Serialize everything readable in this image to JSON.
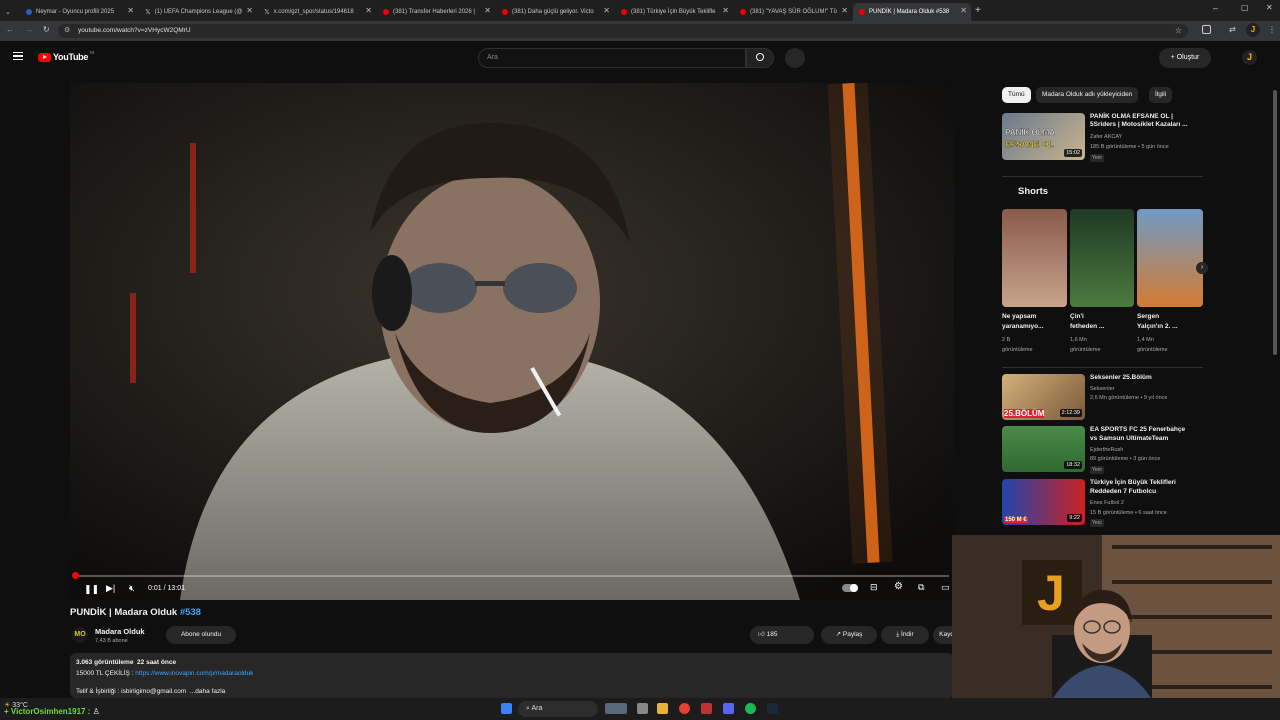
{
  "browser": {
    "tabs": [
      {
        "label": "Neymar - Oyuncu profili 2025"
      },
      {
        "label": "(1) UEFA Champions League (@"
      },
      {
        "label": "x.com/gzt_spor/status/194618"
      },
      {
        "label": "(381) Transfer Haberleri 2026 |"
      },
      {
        "label": "(381) Daha güçlü geliyor. Victo"
      },
      {
        "label": "(381) Türkiye İçin Büyük Teklifle"
      },
      {
        "label": "(381) \"YAVAŞ SÜR OĞLUM!\" Tü"
      },
      {
        "label": "PUNDİK | Madara Olduk #538"
      }
    ],
    "url": "youtube.com/watch?v=zVHycW2QMrU"
  },
  "youtube": {
    "logo": "YouTube",
    "logo_region": "TR",
    "search_placeholder": "Ara",
    "create_label": "Oluştur",
    "avatar_letter": "J"
  },
  "player": {
    "time": "0:01 / 13:01",
    "progress": 0.0013
  },
  "video": {
    "title_main": "PUNDİK | Madara Olduk ",
    "title_tag": "#538",
    "channel_name": "Madara Olduk",
    "subscribers": "7,43 B abone",
    "subscribed_label": "Abone olundu",
    "likes": "185",
    "share_label": "Paylaş",
    "download_label": "İndir",
    "save_label": "Kayd",
    "views_line": "3.063 görüntüleme  22 saat önce",
    "desc_prefix": "15000 TL ÇEKİLİŞ : ",
    "desc_link": "https://www.inovapin.com/p/madaraolduk",
    "desc_line2": "Telif & İşbirliği : isbirligimo@gmail.com  ...daha fazla"
  },
  "sidebar": {
    "chips": [
      "Tümü",
      "Madara Olduk adlı yükleyiciden",
      "İlgili"
    ],
    "top_video": {
      "title": "PANİK OLMA EFSANE OL | 5Sriders | Motosiklet Kazaları ...",
      "channel": "Zafer AKCAY",
      "meta": "185 B görüntüleme • 5 gün önce",
      "badge": "Yeni",
      "duration": "15:02",
      "thumb_text1": "PANİK OLMA",
      "thumb_text2": "EFSANE OL"
    },
    "shorts_title": "Shorts",
    "shorts": [
      {
        "title1": "Ne yapsam",
        "title2": "yaranamıyo...",
        "views1": "2 B",
        "views2": "görüntüleme"
      },
      {
        "title1": "Çin'i",
        "title2": "fetheden ...",
        "views1": "1,6 Mn",
        "views2": "görüntüleme"
      },
      {
        "title1": "Sergen",
        "title2": "Yalçın'ın 2. ...",
        "views1": "1,4 Mn",
        "views2": "görüntüleme"
      }
    ],
    "videos": [
      {
        "title1": "Seksenler 25.Bölüm",
        "title2": "",
        "channel": "Seksenler",
        "meta": "2,6 Mn görüntüleme • 9 yıl önce",
        "badge": "",
        "duration": "2:12:39",
        "thumb_text": "25.BÖLÜM"
      },
      {
        "title1": "EA SPORTS FC 25 Fenerbahçe",
        "title2": "vs Samsun UltimateTeam",
        "channel": "EjdertheRush",
        "meta": "89 görüntüleme • 3 gün önce",
        "badge": "Yeni",
        "duration": "18:32",
        "thumb_text": ""
      },
      {
        "title1": "Türkiye İçin Büyük Teklifleri",
        "title2": "Reddeden 7 Futbolcu",
        "channel": "Enes Futbol 2",
        "meta": "15 B görüntüleme • 6 saat önce",
        "badge": "Yeni",
        "duration": "9:22",
        "thumb_text": "150 M €"
      }
    ]
  },
  "overlay": {
    "chat_user": "VictorOsimhen1917 :",
    "weather": "33°C"
  },
  "taskbar": {
    "search_label": "Ara"
  }
}
